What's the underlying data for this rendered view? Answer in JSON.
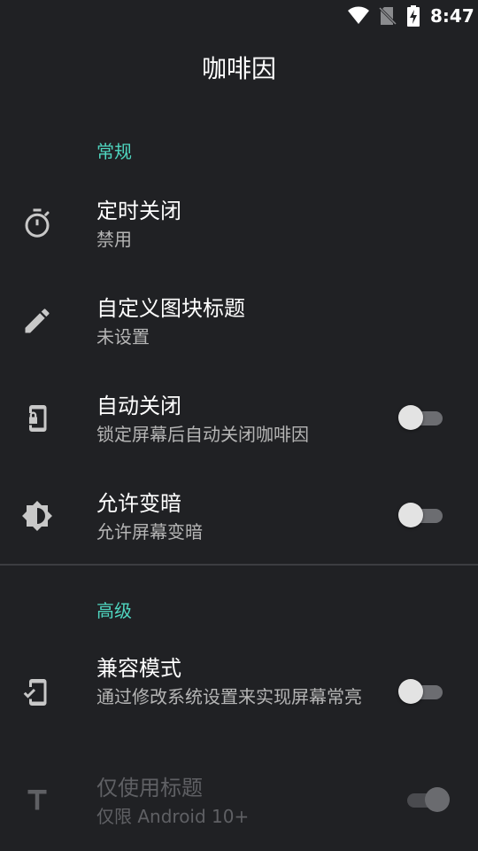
{
  "status_bar": {
    "time": "8:47",
    "icons": [
      "wifi-icon",
      "no-sim-icon",
      "battery-charging-icon"
    ]
  },
  "app": {
    "title": "咖啡因"
  },
  "sections": {
    "general": {
      "header": "常规",
      "items": {
        "timeout": {
          "title": "定时关闭",
          "summary": "禁用",
          "icon": "timer-icon"
        },
        "custom_tile_title": {
          "title": "自定义图块标题",
          "summary": "未设置",
          "icon": "pencil-icon"
        },
        "auto_off": {
          "title": "自动关闭",
          "summary": "锁定屏幕后自动关闭咖啡因",
          "icon": "phone-lock-icon",
          "switch_on": false
        },
        "allow_dim": {
          "title": "允许变暗",
          "summary": "允许屏幕变暗",
          "icon": "brightness-icon",
          "switch_on": false
        }
      }
    },
    "advanced": {
      "header": "高级",
      "items": {
        "compat_mode": {
          "title": "兼容模式",
          "summary": "通过修改系统设置来实现屏幕常亮",
          "icon": "phone-check-icon",
          "switch_on": false
        },
        "title_only": {
          "title": "仅使用标题",
          "summary": "仅限 Android 10+",
          "icon": "text-icon",
          "switch_on": true,
          "enabled": false
        }
      }
    }
  },
  "colors": {
    "background": "#202124",
    "accent": "#4fd6c0",
    "primary_text": "#ffffff",
    "secondary_text": "#b5b5b5",
    "disabled_text": "#5f6064"
  }
}
